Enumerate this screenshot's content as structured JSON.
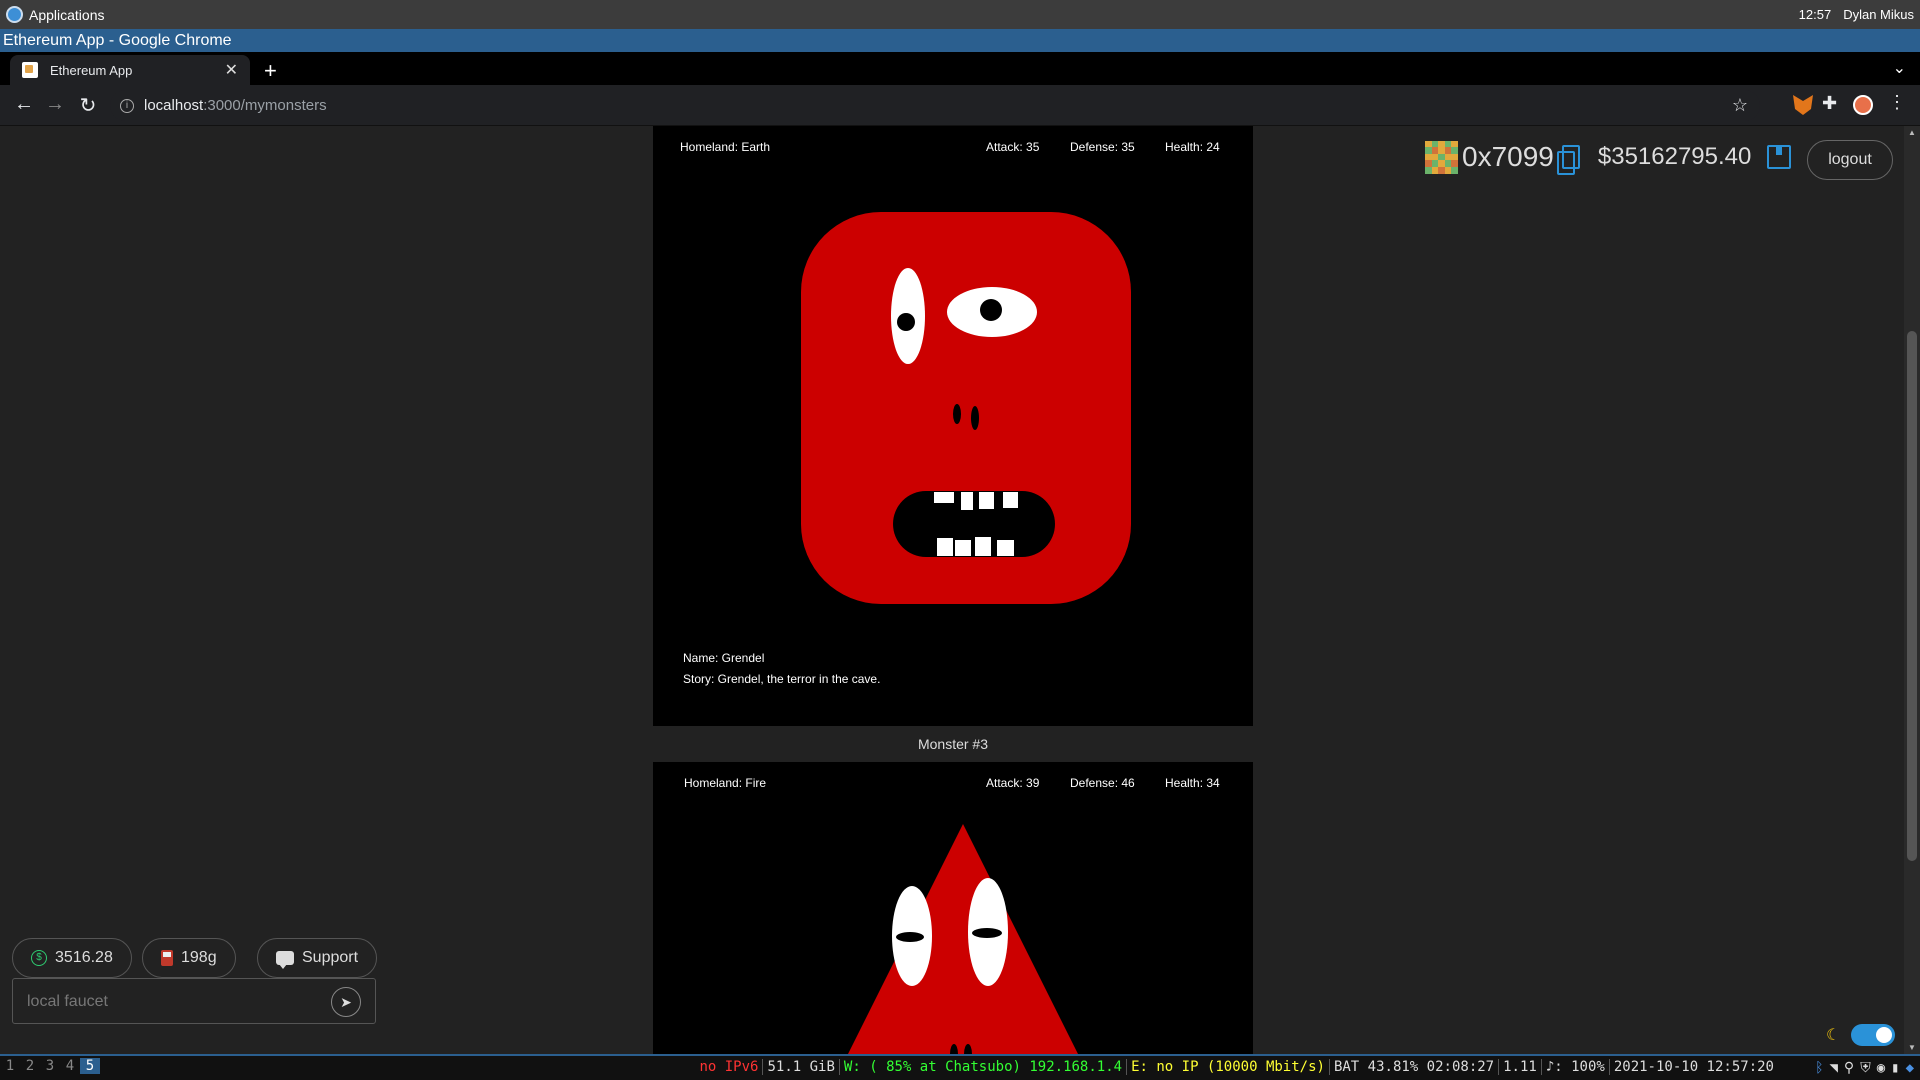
{
  "os": {
    "apps_label": "Applications",
    "time": "12:57",
    "user": "Dylan Mikus"
  },
  "window": {
    "title": "Ethereum App - Google Chrome"
  },
  "browser": {
    "tab_title": "Ethereum App",
    "url_host": "localhost",
    "url_path": ":3000/mymonsters"
  },
  "account": {
    "address": "0x7099",
    "balance": "$35162795.40",
    "logout_label": "logout"
  },
  "monsters": [
    {
      "homeland": "Homeland: Earth",
      "attack": "Attack: 35",
      "defense": "Defense: 35",
      "health": "Health: 24",
      "name": "Name: Grendel",
      "story": "Story: Grendel, the terror in the cave.",
      "color": "#cc0000"
    },
    {
      "label": "Monster #3",
      "homeland": "Homeland: Fire",
      "attack": "Attack: 39",
      "defense": "Defense: 46",
      "health": "Health: 34",
      "color": "#cc0000"
    }
  ],
  "wallet_widget": {
    "eth_price": "3516.28",
    "gas": "198g",
    "support_label": "Support",
    "faucet_placeholder": "local faucet"
  },
  "statusbar": {
    "workspaces": [
      "1",
      "2",
      "3",
      "4",
      "5"
    ],
    "active_workspace": "5",
    "ipv6": "no IPv6",
    "disk": "51.1 GiB",
    "wifi": "W: ( 85% at Chatsubo) 192.168.1.4",
    "ethernet": "E: no IP (10000 Mbit/s)",
    "battery": "BAT 43.81% 02:08:27",
    "load": "1.11",
    "volume": "♪: 100%",
    "datetime": "2021-10-10 12:57:20"
  },
  "colors": {
    "accent": "#2a92d8",
    "monster_red": "#cc0000",
    "ipv6_red": "#ff3333",
    "wifi_green": "#33ff33",
    "eth_yellow": "#ffff33"
  }
}
